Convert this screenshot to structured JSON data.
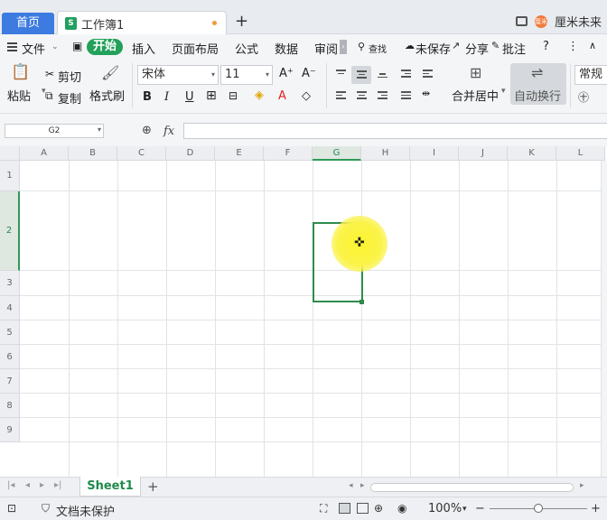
{
  "titlebar": {
    "home_tab": "首页",
    "doc_tab": "工作簿1",
    "doc_icon": "S",
    "new_tab": "+",
    "user": "厘米未来",
    "avatar_text": "厘米"
  },
  "menu": {
    "file": "文件",
    "start": "开始",
    "insert": "插入",
    "layout": "页面布局",
    "formula": "公式",
    "data": "数据",
    "review": "审阅",
    "more_arrow": "›",
    "search": "查找",
    "unsaved": "未保存",
    "share": "分享",
    "comment": "批注",
    "help": "?",
    "more": "⋮",
    "collapse": "∧"
  },
  "ribbon": {
    "paste": "粘贴",
    "cut": "剪切",
    "copy": "复制",
    "format_painter": "格式刷",
    "font_name": "宋体",
    "font_size": "11",
    "increase_font": "A⁺",
    "decrease_font": "A⁻",
    "bold": "B",
    "italic": "I",
    "underline": "U",
    "merge_center": "合并居中",
    "wrap_text": "自动换行",
    "number_format": "常规"
  },
  "formula_bar": {
    "name_box": "G2",
    "fx": "fx"
  },
  "grid": {
    "columns": [
      "A",
      "B",
      "C",
      "D",
      "E",
      "F",
      "G",
      "H",
      "I",
      "J",
      "K",
      "L"
    ],
    "rows": [
      "1",
      "2",
      "3",
      "4",
      "5",
      "6",
      "7",
      "8",
      "9"
    ],
    "selected_column": "G",
    "selected_row": "2"
  },
  "sheets": {
    "tabs": [
      "Sheet1"
    ],
    "add": "+"
  },
  "status": {
    "protect": "文档未保护",
    "zoom": "100%",
    "zoom_minus": "−",
    "zoom_plus": "+"
  }
}
